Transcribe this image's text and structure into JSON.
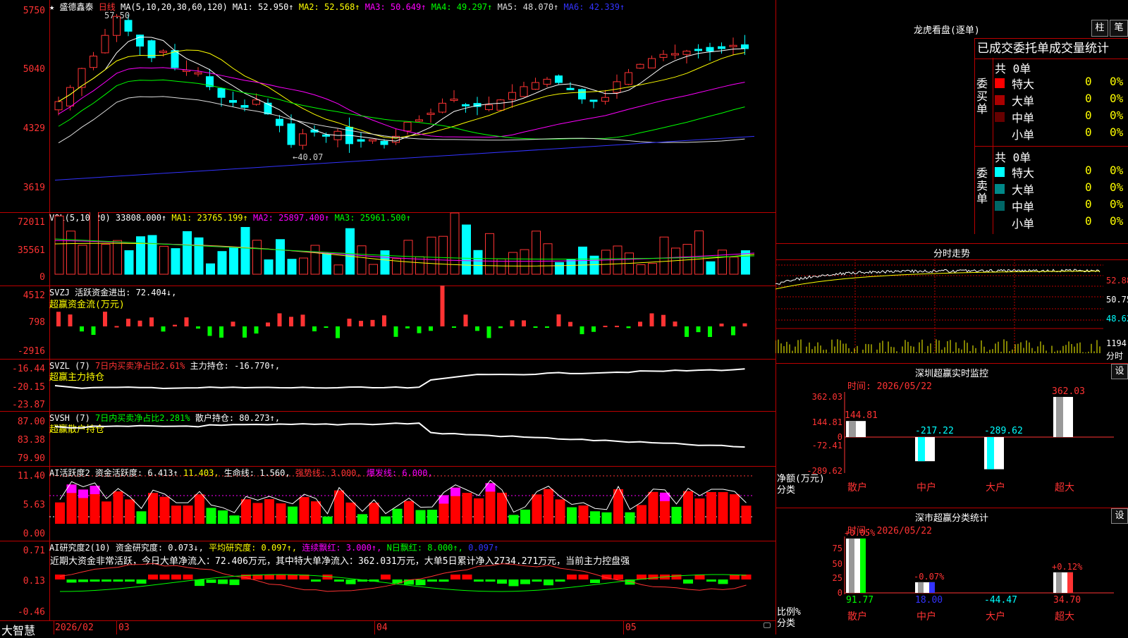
{
  "stock": {
    "star": "★",
    "name": "盛德鑫泰",
    "period": "日线"
  },
  "ma_header": [
    {
      "label": "MA(5,10,20,30,60,120)",
      "color": "#ffffff"
    },
    {
      "label": "MA1: 52.950↑",
      "color": "#ffffff"
    },
    {
      "label": "MA2: 52.568↑",
      "color": "#ffff00"
    },
    {
      "label": "MA3: 50.649↑",
      "color": "#ff00ff"
    },
    {
      "label": "MA4: 49.297↑",
      "color": "#00ff00"
    },
    {
      "label": "MA5: 48.070↑",
      "color": "#dddddd"
    },
    {
      "label": "MA6: 42.339↑",
      "color": "#3333ff"
    }
  ],
  "price_axis": [
    "5750",
    "5040",
    "4329",
    "3619"
  ],
  "price_annotations": {
    "high": "57.50",
    "low": "←40.07"
  },
  "vol_header": [
    {
      "label": "VOL(5,10,20)  33808.000↑",
      "color": "#ffffff"
    },
    {
      "label": "MA1: 23765.199↑",
      "color": "#ffff00"
    },
    {
      "label": "MA2: 25897.400↑",
      "color": "#ff00ff"
    },
    {
      "label": "MA3: 25961.500↑",
      "color": "#00ff00"
    }
  ],
  "vol_axis": [
    "72011",
    "35561",
    "0"
  ],
  "svzj": {
    "header": "SVZJ  活跃资金进出: 72.404↓,",
    "sub": "超赢资金流(万元)",
    "axis": [
      "4512",
      "798",
      "-2916"
    ]
  },
  "svzl": {
    "header_a": "SVZL (7)",
    "header_b": "7日内买卖净占比2.61%",
    "header_c": "主力持仓: -16.770↑,",
    "sub": "超赢主力持仓",
    "axis": [
      "-16.44",
      "-20.15",
      "-23.87"
    ]
  },
  "svsh": {
    "header_a": "SVSH (7)",
    "header_b": "7日内买卖净占比2.281%",
    "header_c": "散户持仓: 80.273↑,",
    "sub": "超赢散户持仓",
    "axis": [
      "87.00",
      "83.38",
      "79.90"
    ]
  },
  "ai_active": {
    "h1": "AI活跃度2",
    "h2": "资金活跃度: 6.413↑",
    "h3": "11.403,",
    "h4": "生命线: 1.560,",
    "h5": "强势线: 3.000,",
    "h6": "爆发线: 6.000,",
    "axis": [
      "11.40",
      "5.63",
      "0.00"
    ]
  },
  "ai_research": {
    "h1": "AI研究度2(10)",
    "h2": "资金研究度: 0.073↓,",
    "h3": "平均研究度: 0.097↑,",
    "h4": "连续飘红: 3.000↑,",
    "h5": "N日飘红: 8.000↑,",
    "h6": "0.097↑",
    "summary": "近期大资金非常活跃，今日大单净流入：72.406万元，其中特大单净流入：362.031万元，大单5日累计净入2734.271万元，当前主力控盘强",
    "axis": [
      "0.71",
      "0.13",
      "-0.46"
    ]
  },
  "date_axis": [
    "2026/02",
    "03",
    "04",
    "05"
  ],
  "logo": "大智慧",
  "right": {
    "dragon_title": "龙虎看盘(逐单)",
    "btn_zhu": "柱",
    "btn_bi": "笔",
    "tabs": "已成交委托单成交量统计",
    "buy": {
      "side": "委买单",
      "count": "共 0单",
      "rows": [
        {
          "name": "特大",
          "v": "0",
          "p": "0%",
          "color": "#ff0000"
        },
        {
          "name": "大单",
          "v": "0",
          "p": "0%",
          "color": "#aa0000"
        },
        {
          "name": "中单",
          "v": "0",
          "p": "0%",
          "color": "#660000"
        },
        {
          "name": "小单",
          "v": "0",
          "p": "0%",
          "color": "#000000"
        }
      ]
    },
    "sell": {
      "side": "委卖单",
      "count": "共 0单",
      "rows": [
        {
          "name": "特大",
          "v": "0",
          "p": "0%",
          "color": "#00ffff"
        },
        {
          "name": "大单",
          "v": "0",
          "p": "0%",
          "color": "#008888"
        },
        {
          "name": "中单",
          "v": "0",
          "p": "0%",
          "color": "#006666"
        },
        {
          "name": "小单",
          "v": "0",
          "p": "0%",
          "color": "#000000"
        }
      ]
    },
    "intraday_title": "分时走势",
    "intraday_axis": [
      "52.88",
      "50.75",
      "48.62"
    ],
    "intraday_vol": [
      "1194",
      "分时"
    ],
    "sz_title": "深圳超赢实时监控",
    "sz_btn": "设",
    "sz_time": "时间: 2026/05/22",
    "sz_axis": [
      "362.03",
      "144.81",
      "0",
      "-72.41",
      "-289.62"
    ],
    "sz_ylabel": [
      "净额(万元)",
      "分类"
    ],
    "sz_bars": [
      {
        "cat": "散户",
        "value": 144.81,
        "label": "144.81"
      },
      {
        "cat": "中户",
        "value": -217.22,
        "label": "-217.22"
      },
      {
        "cat": "大户",
        "value": -289.62,
        "label": "-289.62"
      },
      {
        "cat": "超大",
        "value": 362.03,
        "label": "362.03"
      }
    ],
    "cls_title": "深市超赢分类统计",
    "cls_btn": "设",
    "cls_time": "时间: 2026/05/22",
    "cls_axis": [
      "75",
      "50",
      "25",
      "0"
    ],
    "cls_ylabel": [
      "比例%",
      "分类"
    ],
    "cls_bars": [
      {
        "cat": "散户",
        "value": 91.77,
        "label": "91.77",
        "pct": "+0.05%"
      },
      {
        "cat": "中户",
        "value": 18.0,
        "label": "18.00",
        "pct": "-0.07%"
      },
      {
        "cat": "大户",
        "value": -44.47,
        "label": "-44.47",
        "pct": ""
      },
      {
        "cat": "超大",
        "value": 34.7,
        "label": "34.70",
        "pct": "+0.12%"
      }
    ]
  }
}
